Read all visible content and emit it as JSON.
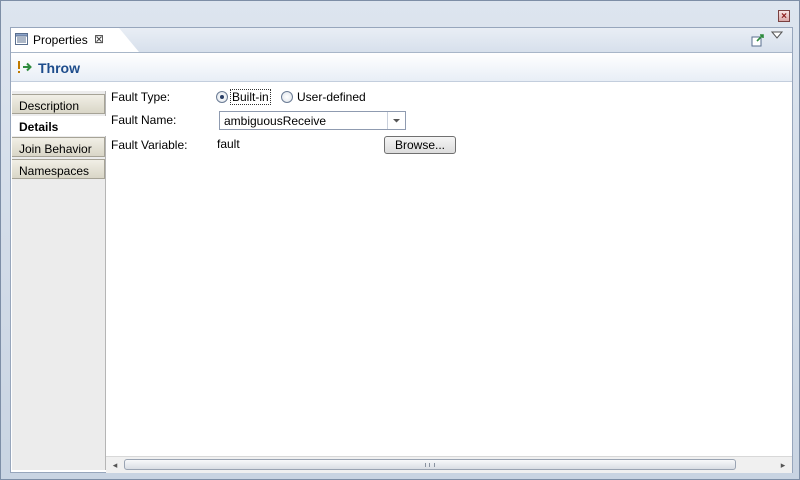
{
  "view": {
    "tab_label": "Properties",
    "tab_close": "⊠"
  },
  "header": {
    "title": "Throw"
  },
  "sidebar": {
    "items": [
      {
        "label": "Description"
      },
      {
        "label": "Details"
      },
      {
        "label": "Join Behavior"
      },
      {
        "label": "Namespaces"
      }
    ],
    "active": "Details"
  },
  "form": {
    "fault_type_label": "Fault Type:",
    "fault_type_options": [
      "Built-in",
      "User-defined"
    ],
    "fault_type_selected": "Built-in",
    "fault_name_label": "Fault Name:",
    "fault_name_value": "ambiguousReceive",
    "fault_variable_label": "Fault Variable:",
    "fault_variable_value": "fault",
    "browse_label": "Browse..."
  },
  "colors": {
    "title": "#1e4d8c",
    "window_frame": "#7d8ea6"
  }
}
